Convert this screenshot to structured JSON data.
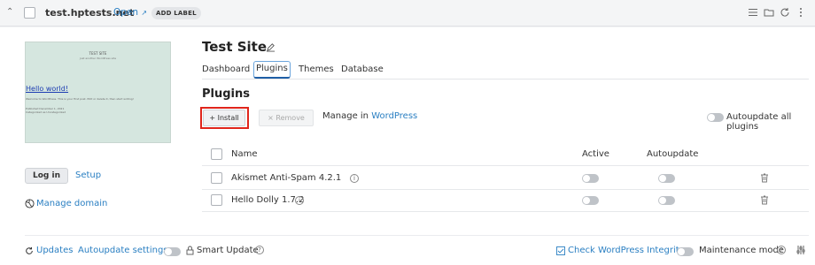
{
  "header": {
    "domain": "test.hptests.net",
    "open_label": "Open",
    "add_label": "ADD LABEL"
  },
  "preview": {
    "site_name": "TEST SITE",
    "tagline": "Just another WordPress site",
    "post_title": "Hello world!",
    "post_excerpt": "Welcome to WordPress. This is your first post. Edit or delete it, then start writing!",
    "post_meta_1": "Published December 1, 2021",
    "post_meta_2": "Categorized as Uncategorized"
  },
  "left": {
    "login_label": "Log in",
    "setup_label": "Setup",
    "manage_domain_label": "Manage domain"
  },
  "site": {
    "title": "Test Site",
    "tabs": [
      {
        "label": "Dashboard"
      },
      {
        "label": "Plugins"
      },
      {
        "label": "Themes"
      },
      {
        "label": "Database"
      }
    ],
    "active_tab": "Plugins"
  },
  "plugins": {
    "section_title": "Plugins",
    "install_label": "Install",
    "remove_label": "Remove",
    "manage_prefix": "Manage in",
    "manage_link": "WordPress",
    "autoupdate_all_label": "Autoupdate all plugins",
    "columns": {
      "name": "Name",
      "active": "Active",
      "autoupdate": "Autoupdate"
    },
    "rows": [
      {
        "name": "Akismet Anti-Spam 4.2.1",
        "active": false,
        "autoupdate": false
      },
      {
        "name": "Hello Dolly 1.7.2",
        "active": false,
        "autoupdate": false
      }
    ]
  },
  "footer": {
    "updates_label": "Updates",
    "autoupdate_settings_label": "Autoupdate settings",
    "smart_update_label": "Smart Update",
    "check_integrity_label": "Check WordPress Integrity",
    "maintenance_label": "Maintenance mode"
  },
  "colors": {
    "accent": "#2a7fc2",
    "highlight": "#e0251b",
    "thumbnail_bg": "#d5e6df"
  }
}
